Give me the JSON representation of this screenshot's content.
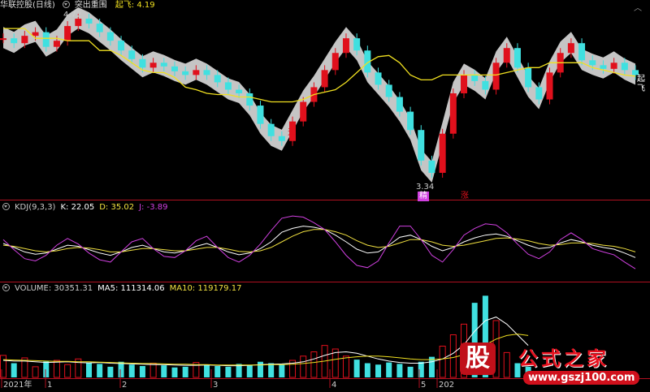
{
  "header": {
    "stock_name": "华联控股(日线)",
    "indicator_name": "突出重围",
    "signal_label": "起飞: 4.19",
    "price_max": "4.72",
    "price_min": "3.34"
  },
  "signals": {
    "takeoff_tag": "起飞",
    "buy_tag": "精",
    "rise_tag": "涨",
    "sky_tag": "天"
  },
  "kdj": {
    "title": "KDJ(9,3,3)",
    "k": "K: 22.05",
    "d": "D: 35.02",
    "j": "J: -3.89"
  },
  "volume": {
    "title": "VOLUME: 30351.31",
    "ma5": "MA5: 111314.06",
    "ma10": "MA10: 119179.17"
  },
  "time_axis": [
    "2021年",
    "1",
    "2",
    "3",
    "4",
    "5",
    "202"
  ],
  "watermark": {
    "logo_char": "股",
    "title": "公式之家",
    "url": "www.gszj100.com"
  },
  "colors": {
    "bull": "#e0101c",
    "bear": "#40e0e0",
    "ma_line": "#f0e020",
    "kdj_k": "#ffffff",
    "kdj_d": "#f0e040",
    "kdj_j": "#d040e0",
    "panel_border": "#b01020",
    "band_fill": "#e8e8e8",
    "dark_band": "#0a3a1a"
  },
  "chart_data": [
    {
      "type": "line",
      "name": "price",
      "ylim": [
        3.34,
        4.72
      ],
      "x": [
        0,
        1,
        2,
        3,
        4,
        5,
        6,
        7,
        8,
        9,
        10,
        11,
        12,
        13,
        14,
        15,
        16,
        17,
        18,
        19,
        20,
        21,
        22,
        23,
        24,
        25,
        26,
        27,
        28,
        29,
        30,
        31,
        32,
        33,
        34,
        35,
        36,
        37,
        38,
        39,
        40,
        41,
        42,
        43,
        44,
        45,
        46,
        47,
        48,
        49,
        50,
        51,
        52,
        53,
        54,
        55,
        56,
        57,
        58,
        59
      ],
      "series": [
        {
          "values": [
            4.5,
            4.46,
            4.52,
            4.55,
            4.43,
            4.48,
            4.6,
            4.66,
            4.62,
            4.55,
            4.48,
            4.4,
            4.33,
            4.26,
            4.3,
            4.27,
            4.23,
            4.2,
            4.24,
            4.2,
            4.14,
            4.08,
            4.05,
            3.95,
            3.8,
            3.7,
            3.66,
            3.82,
            3.98,
            4.1,
            4.24,
            4.38,
            4.5,
            4.4,
            4.22,
            4.12,
            4.02,
            3.9,
            3.75,
            3.5,
            3.4,
            3.72,
            4.05,
            4.2,
            4.15,
            4.08,
            4.3,
            4.42,
            4.26,
            4.1,
            4.0,
            4.22,
            4.38,
            4.46,
            4.32,
            4.28,
            4.25,
            4.3,
            4.24,
            4.2
          ]
        },
        {
          "name": "起飞",
          "values": [
            4.58,
            4.58,
            4.58,
            4.5,
            4.5,
            4.5,
            4.48,
            4.48,
            4.48,
            4.4,
            4.4,
            4.36,
            4.3,
            4.24,
            4.22,
            4.22,
            4.18,
            4.1,
            4.08,
            4.05,
            4.04,
            4.04,
            4.02,
            4.02,
            4.0,
            3.98,
            3.98,
            3.98,
            4.0,
            4.04,
            4.06,
            4.08,
            4.14,
            4.22,
            4.3,
            4.35,
            4.36,
            4.3,
            4.2,
            4.16,
            4.16,
            4.2,
            4.2,
            4.2,
            4.2,
            4.2,
            4.2,
            4.22,
            4.24,
            4.26,
            4.26,
            4.3,
            4.3,
            4.3,
            4.3,
            4.26,
            4.24,
            4.22,
            4.2,
            4.19
          ]
        }
      ]
    },
    {
      "type": "line",
      "name": "KDJ",
      "ylim": [
        -10,
        110
      ],
      "series": [
        {
          "name": "K",
          "values": [
            55,
            48,
            40,
            36,
            38,
            45,
            52,
            50,
            44,
            38,
            34,
            40,
            48,
            52,
            46,
            40,
            38,
            42,
            50,
            55,
            48,
            40,
            35,
            38,
            46,
            58,
            75,
            82,
            86,
            84,
            80,
            70,
            58,
            45,
            38,
            40,
            52,
            66,
            70,
            62,
            50,
            42,
            48,
            58,
            65,
            70,
            72,
            68,
            60,
            52,
            46,
            48,
            56,
            62,
            58,
            52,
            48,
            45,
            38,
            30
          ]
        },
        {
          "name": "D",
          "values": [
            52,
            50,
            46,
            42,
            40,
            42,
            46,
            48,
            47,
            44,
            40,
            40,
            43,
            46,
            46,
            44,
            42,
            42,
            45,
            48,
            48,
            45,
            41,
            40,
            42,
            48,
            58,
            68,
            76,
            80,
            80,
            76,
            70,
            60,
            52,
            48,
            50,
            56,
            62,
            62,
            58,
            52,
            50,
            52,
            56,
            60,
            64,
            65,
            63,
            60,
            55,
            52,
            53,
            56,
            56,
            55,
            52,
            50,
            46,
            40
          ]
        },
        {
          "name": "J",
          "values": [
            62,
            44,
            28,
            24,
            34,
            52,
            64,
            54,
            38,
            26,
            22,
            40,
            58,
            64,
            46,
            32,
            30,
            42,
            60,
            68,
            48,
            30,
            22,
            34,
            54,
            78,
            100,
            104,
            102,
            92,
            80,
            58,
            34,
            16,
            12,
            24,
            56,
            86,
            86,
            62,
            34,
            22,
            44,
            70,
            82,
            90,
            88,
            74,
            54,
            36,
            28,
            40,
            62,
            74,
            62,
            46,
            40,
            35,
            22,
            10
          ]
        }
      ]
    },
    {
      "type": "bar",
      "name": "VOLUME",
      "series": [
        {
          "name": "VOLUME",
          "values": [
            62,
            40,
            55,
            30,
            45,
            48,
            36,
            52,
            40,
            38,
            30,
            44,
            36,
            32,
            40,
            34,
            28,
            30,
            42,
            36,
            32,
            30,
            38,
            34,
            44,
            40,
            36,
            48,
            60,
            72,
            90,
            80,
            60,
            50,
            40,
            36,
            42,
            38,
            30,
            44,
            58,
            88,
            120,
            150,
            210,
            230,
            160,
            70,
            40,
            30,
            0,
            0,
            0,
            0,
            0,
            0,
            0,
            0,
            0,
            0
          ]
        },
        {
          "name": "MA5",
          "values": [
            48,
            46,
            46,
            44,
            42,
            43,
            44,
            42,
            41,
            42,
            40,
            39,
            38,
            37,
            36,
            36,
            35,
            34,
            34,
            35,
            34,
            33,
            33,
            34,
            36,
            37,
            38,
            40,
            44,
            52,
            62,
            70,
            72,
            68,
            60,
            52,
            46,
            42,
            40,
            40,
            44,
            52,
            68,
            92,
            130,
            160,
            170,
            150,
            120,
            90,
            0,
            0,
            0,
            0,
            0,
            0,
            0,
            0,
            0,
            0
          ]
        },
        {
          "name": "MA10",
          "values": [
            50,
            49,
            48,
            47,
            46,
            45,
            45,
            44,
            44,
            43,
            42,
            41,
            40,
            39,
            39,
            38,
            37,
            37,
            36,
            36,
            35,
            35,
            35,
            35,
            35,
            36,
            36,
            37,
            39,
            42,
            46,
            51,
            55,
            58,
            60,
            60,
            58,
            55,
            52,
            50,
            50,
            52,
            56,
            64,
            76,
            92,
            108,
            118,
            122,
            118,
            0,
            0,
            0,
            0,
            0,
            0,
            0,
            0,
            0,
            0
          ]
        }
      ]
    }
  ]
}
